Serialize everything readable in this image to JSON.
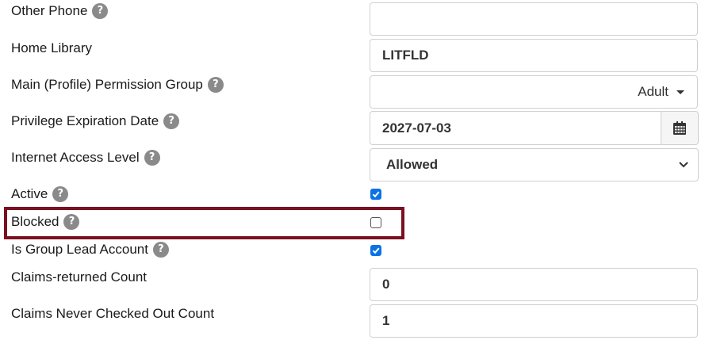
{
  "fields": {
    "other_phone": {
      "label": "Other Phone",
      "value": ""
    },
    "home_library": {
      "label": "Home Library",
      "value": "LITFLD"
    },
    "permission_group": {
      "label": "Main (Profile) Permission Group",
      "value": "Adult"
    },
    "privilege_expiration": {
      "label": "Privilege Expiration Date",
      "value": "2027-07-03"
    },
    "internet_access": {
      "label": "Internet Access Level",
      "value": "Allowed"
    },
    "active": {
      "label": "Active",
      "checked": true
    },
    "blocked": {
      "label": "Blocked",
      "checked": false
    },
    "group_lead": {
      "label": "Is Group Lead Account",
      "checked": true
    },
    "claims_returned": {
      "label": "Claims-returned Count",
      "value": "0"
    },
    "claims_never": {
      "label": "Claims Never Checked Out Count",
      "value": "1"
    }
  },
  "help_glyph": "?",
  "icons": {
    "help": "question-circle-icon",
    "calendar": "calendar-icon",
    "caret": "caret-down-icon",
    "chevron": "chevron-down-icon",
    "check": "check-icon"
  },
  "colors": {
    "checkbox_checked": "#0a72e5",
    "highlight_border": "#7a1020",
    "help_icon": "#8a8a8a"
  }
}
